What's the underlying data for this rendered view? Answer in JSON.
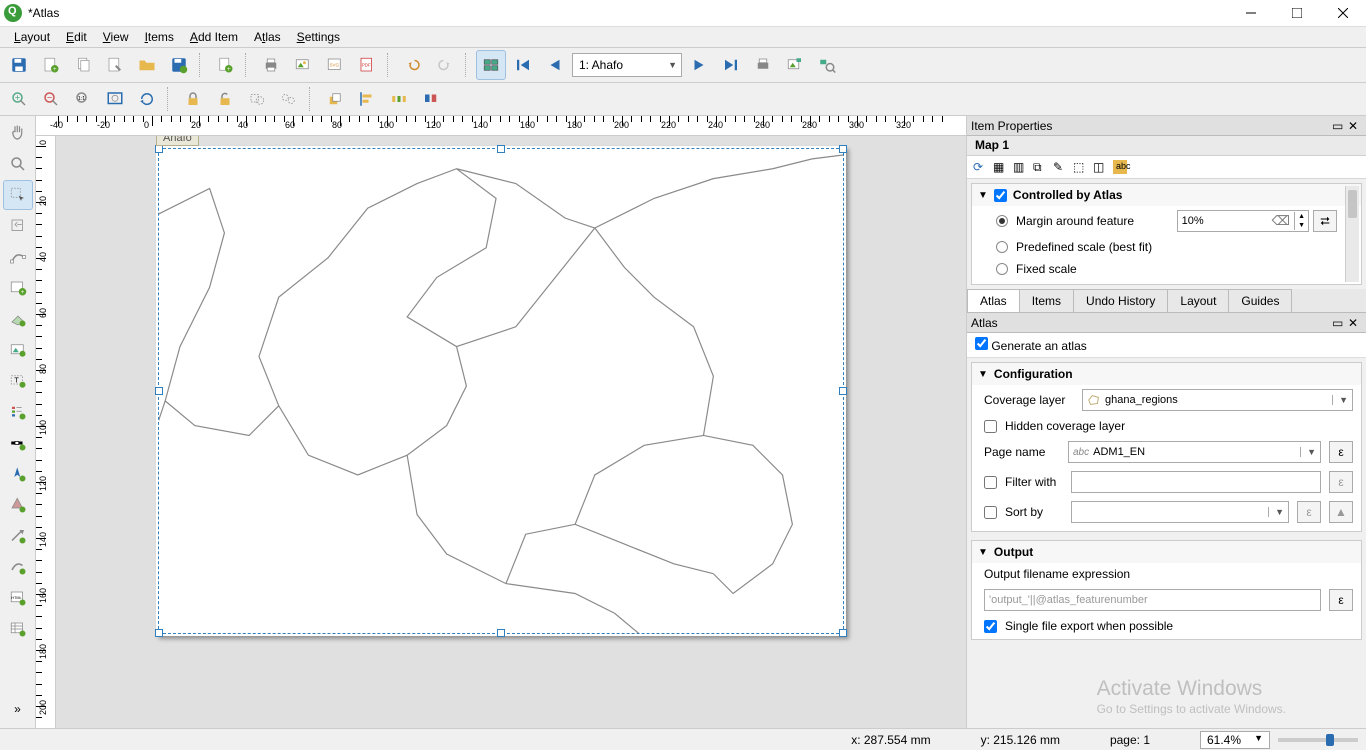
{
  "window": {
    "title": "*Atlas"
  },
  "menubar": [
    "Layout",
    "Edit",
    "View",
    "Items",
    "Add Item",
    "Atlas",
    "Settings"
  ],
  "toolbar_main": {
    "feature_combo": "1: Ahafo"
  },
  "hruler_labels": [
    "-40",
    "-20",
    "0",
    "20",
    "40",
    "60",
    "80",
    "100",
    "120",
    "140",
    "160",
    "180",
    "200",
    "220",
    "240",
    "260",
    "280",
    "300",
    "320"
  ],
  "vruler_labels": [
    "0",
    "20",
    "40",
    "60",
    "80",
    "100",
    "120",
    "140",
    "160",
    "180",
    "200"
  ],
  "page_label": "Ahafo",
  "item_props": {
    "header": "Item Properties",
    "subheader": "Map 1",
    "group": "Controlled by Atlas",
    "margin_label": "Margin around feature",
    "margin_value": "10%",
    "predef_label": "Predefined scale (best fit)",
    "fixed_label": "Fixed scale"
  },
  "tabs": [
    "Atlas",
    "Items",
    "Undo History",
    "Layout",
    "Guides"
  ],
  "atlas": {
    "header": "Atlas",
    "generate": "Generate an atlas",
    "config_hdr": "Configuration",
    "coverage_label": "Coverage layer",
    "coverage_value": "ghana_regions",
    "hidden_label": "Hidden coverage layer",
    "page_name_label": "Page name",
    "page_name_value": "ADM1_EN",
    "filter_label": "Filter with",
    "sort_label": "Sort by",
    "output_hdr": "Output",
    "output_expr_label": "Output filename expression",
    "output_expr_value": "'output_'||@atlas_featurenumber",
    "single_file": "Single file export when possible"
  },
  "statusbar": {
    "x": "x: 287.554 mm",
    "y": "y: 215.126 mm",
    "page": "page: 1",
    "zoom": "61.4%"
  },
  "watermark": {
    "title": "Activate Windows",
    "sub": "Go to Settings to activate Windows."
  }
}
